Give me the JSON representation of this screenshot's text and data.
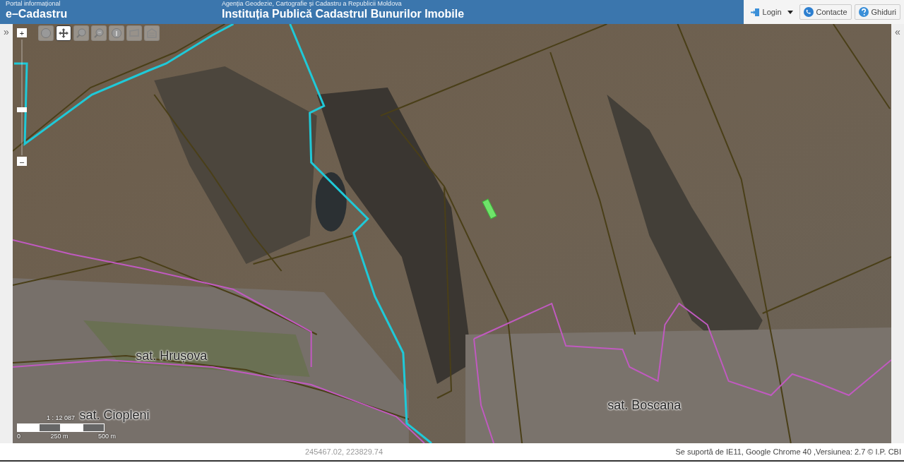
{
  "header": {
    "portal_caption": "Portal informațional",
    "portal_title": "e–Cadastru",
    "agency_caption": "Agenția Geodezie, Cartografie și Cadastru a Republicii Moldova",
    "agency_title": "Instituția Publică Cadastrul Bunurilor Imobile",
    "buttons": [
      {
        "kind": "login",
        "label": "Login"
      },
      {
        "kind": "contact",
        "label": "Contacte"
      },
      {
        "kind": "help",
        "label": "Ghiduri"
      }
    ]
  },
  "left_toggle": "»",
  "right_toggle": "«",
  "map": {
    "zoom_in": "+",
    "zoom_out": "–",
    "zoom_slider": {
      "level": 0.39
    },
    "tools": [
      {
        "kind": "globe",
        "selected": false
      },
      {
        "kind": "pan",
        "selected": true
      },
      {
        "kind": "zoom-in",
        "selected": false
      },
      {
        "kind": "zoom-out",
        "selected": false
      },
      {
        "kind": "info",
        "selected": false
      },
      {
        "kind": "measure",
        "selected": false
      },
      {
        "kind": "area",
        "selected": false
      }
    ],
    "places": [
      {
        "label": "sat. Hrușova"
      },
      {
        "label": "sat. Boscana"
      },
      {
        "label": "sat. Ciopleni"
      }
    ],
    "scale": {
      "ratio": "1 : 12 087",
      "ticks": [
        "0",
        "250 m",
        "500 m"
      ]
    }
  },
  "status_bar": {
    "coordinates": "245467.02, 223829.74",
    "support": "Se suportă de IE11, Google Chrome 40 ,Versiunea: 2.7 © I.P. CBI"
  }
}
